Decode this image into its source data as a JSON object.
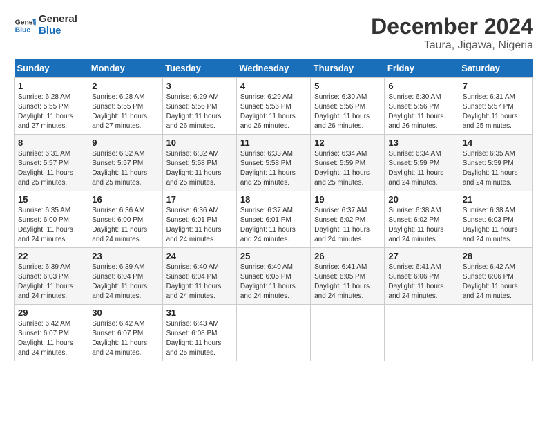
{
  "header": {
    "logo_line1": "General",
    "logo_line2": "Blue",
    "month_title": "December 2024",
    "location": "Taura, Jigawa, Nigeria"
  },
  "weekdays": [
    "Sunday",
    "Monday",
    "Tuesday",
    "Wednesday",
    "Thursday",
    "Friday",
    "Saturday"
  ],
  "weeks": [
    [
      {
        "day": "1",
        "sunrise": "6:28 AM",
        "sunset": "5:55 PM",
        "daylight": "11 hours and 27 minutes."
      },
      {
        "day": "2",
        "sunrise": "6:28 AM",
        "sunset": "5:55 PM",
        "daylight": "11 hours and 27 minutes."
      },
      {
        "day": "3",
        "sunrise": "6:29 AM",
        "sunset": "5:56 PM",
        "daylight": "11 hours and 26 minutes."
      },
      {
        "day": "4",
        "sunrise": "6:29 AM",
        "sunset": "5:56 PM",
        "daylight": "11 hours and 26 minutes."
      },
      {
        "day": "5",
        "sunrise": "6:30 AM",
        "sunset": "5:56 PM",
        "daylight": "11 hours and 26 minutes."
      },
      {
        "day": "6",
        "sunrise": "6:30 AM",
        "sunset": "5:56 PM",
        "daylight": "11 hours and 26 minutes."
      },
      {
        "day": "7",
        "sunrise": "6:31 AM",
        "sunset": "5:57 PM",
        "daylight": "11 hours and 25 minutes."
      }
    ],
    [
      {
        "day": "8",
        "sunrise": "6:31 AM",
        "sunset": "5:57 PM",
        "daylight": "11 hours and 25 minutes."
      },
      {
        "day": "9",
        "sunrise": "6:32 AM",
        "sunset": "5:57 PM",
        "daylight": "11 hours and 25 minutes."
      },
      {
        "day": "10",
        "sunrise": "6:32 AM",
        "sunset": "5:58 PM",
        "daylight": "11 hours and 25 minutes."
      },
      {
        "day": "11",
        "sunrise": "6:33 AM",
        "sunset": "5:58 PM",
        "daylight": "11 hours and 25 minutes."
      },
      {
        "day": "12",
        "sunrise": "6:34 AM",
        "sunset": "5:59 PM",
        "daylight": "11 hours and 25 minutes."
      },
      {
        "day": "13",
        "sunrise": "6:34 AM",
        "sunset": "5:59 PM",
        "daylight": "11 hours and 24 minutes."
      },
      {
        "day": "14",
        "sunrise": "6:35 AM",
        "sunset": "5:59 PM",
        "daylight": "11 hours and 24 minutes."
      }
    ],
    [
      {
        "day": "15",
        "sunrise": "6:35 AM",
        "sunset": "6:00 PM",
        "daylight": "11 hours and 24 minutes."
      },
      {
        "day": "16",
        "sunrise": "6:36 AM",
        "sunset": "6:00 PM",
        "daylight": "11 hours and 24 minutes."
      },
      {
        "day": "17",
        "sunrise": "6:36 AM",
        "sunset": "6:01 PM",
        "daylight": "11 hours and 24 minutes."
      },
      {
        "day": "18",
        "sunrise": "6:37 AM",
        "sunset": "6:01 PM",
        "daylight": "11 hours and 24 minutes."
      },
      {
        "day": "19",
        "sunrise": "6:37 AM",
        "sunset": "6:02 PM",
        "daylight": "11 hours and 24 minutes."
      },
      {
        "day": "20",
        "sunrise": "6:38 AM",
        "sunset": "6:02 PM",
        "daylight": "11 hours and 24 minutes."
      },
      {
        "day": "21",
        "sunrise": "6:38 AM",
        "sunset": "6:03 PM",
        "daylight": "11 hours and 24 minutes."
      }
    ],
    [
      {
        "day": "22",
        "sunrise": "6:39 AM",
        "sunset": "6:03 PM",
        "daylight": "11 hours and 24 minutes."
      },
      {
        "day": "23",
        "sunrise": "6:39 AM",
        "sunset": "6:04 PM",
        "daylight": "11 hours and 24 minutes."
      },
      {
        "day": "24",
        "sunrise": "6:40 AM",
        "sunset": "6:04 PM",
        "daylight": "11 hours and 24 minutes."
      },
      {
        "day": "25",
        "sunrise": "6:40 AM",
        "sunset": "6:05 PM",
        "daylight": "11 hours and 24 minutes."
      },
      {
        "day": "26",
        "sunrise": "6:41 AM",
        "sunset": "6:05 PM",
        "daylight": "11 hours and 24 minutes."
      },
      {
        "day": "27",
        "sunrise": "6:41 AM",
        "sunset": "6:06 PM",
        "daylight": "11 hours and 24 minutes."
      },
      {
        "day": "28",
        "sunrise": "6:42 AM",
        "sunset": "6:06 PM",
        "daylight": "11 hours and 24 minutes."
      }
    ],
    [
      {
        "day": "29",
        "sunrise": "6:42 AM",
        "sunset": "6:07 PM",
        "daylight": "11 hours and 24 minutes."
      },
      {
        "day": "30",
        "sunrise": "6:42 AM",
        "sunset": "6:07 PM",
        "daylight": "11 hours and 24 minutes."
      },
      {
        "day": "31",
        "sunrise": "6:43 AM",
        "sunset": "6:08 PM",
        "daylight": "11 hours and 25 minutes."
      },
      null,
      null,
      null,
      null
    ]
  ],
  "labels": {
    "sunrise": "Sunrise:",
    "sunset": "Sunset:",
    "daylight": "Daylight:"
  }
}
